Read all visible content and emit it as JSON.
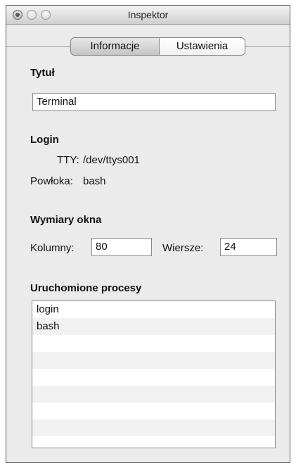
{
  "window": {
    "title": "Inspektor"
  },
  "tabs": {
    "info": "Informacje",
    "settings": "Ustawienia"
  },
  "title_section": {
    "heading": "Tytuł",
    "value": "Terminal"
  },
  "login": {
    "heading": "Login",
    "tty_label": "TTY:",
    "tty_value": "/dev/ttys001",
    "shell_label": "Powłoka:",
    "shell_value": "bash"
  },
  "dimensions": {
    "heading": "Wymiary okna",
    "columns_label": "Kolumny:",
    "columns_value": "80",
    "rows_label": "Wiersze:",
    "rows_value": "24"
  },
  "processes": {
    "heading": "Uruchomione procesy",
    "items": [
      "login",
      "bash",
      "",
      "",
      "",
      "",
      "",
      ""
    ]
  }
}
